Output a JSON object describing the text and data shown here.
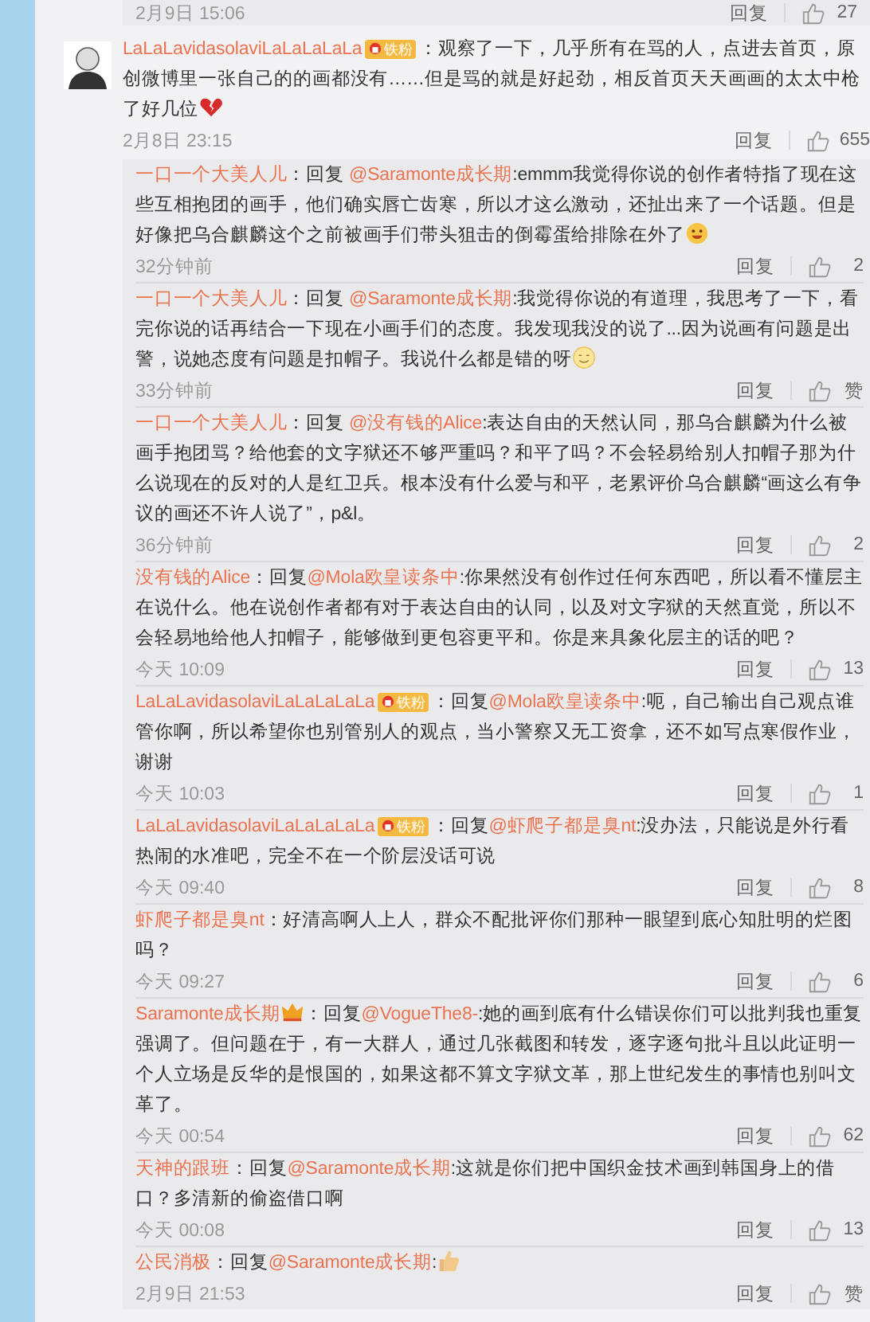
{
  "top_meta": {
    "time": "2月9日 15:06",
    "reply": "回复",
    "likes": "27"
  },
  "comment": {
    "parts": [
      {
        "kind": "user",
        "text": "LaLaLavidasolaviLaLaLaLaLa"
      },
      {
        "kind": "badge",
        "text": "铁粉"
      },
      {
        "kind": "text",
        "text": "：观察了一下，几乎所有在骂的人，点进去首页，原创微博里一张自己的的画都没有……但是骂的就是好起劲，相反首页天天画画的太太中枪了好几位"
      },
      {
        "kind": "heart"
      }
    ],
    "time": "2月8日 23:15",
    "reply": "回复",
    "likes": "655"
  },
  "replies": [
    {
      "parts": [
        {
          "kind": "user",
          "text": "一口一个大美人儿"
        },
        {
          "kind": "text",
          "text": "：回复 "
        },
        {
          "kind": "mention",
          "text": "@Saramonte成长期"
        },
        {
          "kind": "text",
          "text": ":emmm我觉得你说的创作者特指了现在这些互相抱团的画手，他们确实唇亡齿寒，所以才这么激动，还扯出来了一个话题。但是好像把乌合麒麟这个之前被画手们带头狙击的倒霉蛋给排除在外了"
        },
        {
          "kind": "grin"
        }
      ],
      "time": "32分钟前",
      "reply": "回复",
      "likes": "2"
    },
    {
      "parts": [
        {
          "kind": "user",
          "text": "一口一个大美人儿"
        },
        {
          "kind": "text",
          "text": "：回复 "
        },
        {
          "kind": "mention",
          "text": "@Saramonte成长期"
        },
        {
          "kind": "text",
          "text": ":我觉得你说的有道理，我思考了一下，看完你说的话再结合一下现在小画手们的态度。我发现我没的说了...因为说画有问题是出警，说她态度有问题是扣帽子。我说什么都是错的呀"
        },
        {
          "kind": "smile"
        }
      ],
      "time": "33分钟前",
      "reply": "回复",
      "likes": "赞"
    },
    {
      "parts": [
        {
          "kind": "user",
          "text": "一口一个大美人儿"
        },
        {
          "kind": "text",
          "text": "：回复 "
        },
        {
          "kind": "mention",
          "text": "@没有钱的Alice"
        },
        {
          "kind": "text",
          "text": ":表达自由的天然认同，那乌合麒麟为什么被画手抱团骂？给他套的文字狱还不够严重吗？和平了吗？不会轻易给别人扣帽子那为什么说现在的反对的人是红卫兵。根本没有什么爱与和平，老累评价乌合麒麟“画这么有争议的画还不许人说了”，p&l。"
        }
      ],
      "time": "36分钟前",
      "reply": "回复",
      "likes": "2"
    },
    {
      "parts": [
        {
          "kind": "user",
          "text": "没有钱的Alice"
        },
        {
          "kind": "text",
          "text": "：回复"
        },
        {
          "kind": "mention",
          "text": "@Mola欧皇读条中"
        },
        {
          "kind": "text",
          "text": ":你果然没有创作过任何东西吧，所以看不懂层主在说什么。他在说创作者都有对于表达自由的认同，以及对文字狱的天然直觉，所以不会轻易地给他人扣帽子，能够做到更包容更平和。你是来具象化层主的话的吧？"
        }
      ],
      "time": "今天 10:09",
      "reply": "回复",
      "likes": "13"
    },
    {
      "parts": [
        {
          "kind": "user",
          "text": "LaLaLavidasolaviLaLaLaLaLa"
        },
        {
          "kind": "badge",
          "text": "铁粉"
        },
        {
          "kind": "text",
          "text": "：回复"
        },
        {
          "kind": "mention",
          "text": "@Mola欧皇读条中"
        },
        {
          "kind": "text",
          "text": ":呃，自己输出自己观点谁管你啊，所以希望你也别管别人的观点，当小警察又无工资拿，还不如写点寒假作业，谢谢"
        }
      ],
      "time": "今天 10:03",
      "reply": "回复",
      "likes": "1"
    },
    {
      "parts": [
        {
          "kind": "user",
          "text": "LaLaLavidasolaviLaLaLaLaLa"
        },
        {
          "kind": "badge",
          "text": "铁粉"
        },
        {
          "kind": "text",
          "text": "：回复"
        },
        {
          "kind": "mention",
          "text": "@虾爬子都是臭nt"
        },
        {
          "kind": "text",
          "text": ":没办法，只能说是外行看热闹的水准吧，完全不在一个阶层没话可说"
        }
      ],
      "time": "今天 09:40",
      "reply": "回复",
      "likes": "8"
    },
    {
      "parts": [
        {
          "kind": "user",
          "text": "虾爬子都是臭nt"
        },
        {
          "kind": "text",
          "text": "：好清高啊人上人，群众不配批评你们那种一眼望到底心知肚明的烂图吗？"
        }
      ],
      "time": "今天 09:27",
      "reply": "回复",
      "likes": "6"
    },
    {
      "parts": [
        {
          "kind": "user",
          "text": "Saramonte成长期"
        },
        {
          "kind": "crown"
        },
        {
          "kind": "text",
          "text": "：回复"
        },
        {
          "kind": "mention",
          "text": "@VogueThe8-"
        },
        {
          "kind": "text",
          "text": ":她的画到底有什么错误你们可以批判我也重复强调了。但问题在于，有一大群人，通过几张截图和转发，逐字逐句批斗且以此证明一个人立场是反华的是恨国的，如果这都不算文字狱文革，那上世纪发生的事情也别叫文革了。"
        }
      ],
      "time": "今天 00:54",
      "reply": "回复",
      "likes": "62"
    },
    {
      "parts": [
        {
          "kind": "user",
          "text": "天神的跟班"
        },
        {
          "kind": "text",
          "text": "：回复"
        },
        {
          "kind": "mention",
          "text": "@Saramonte成长期"
        },
        {
          "kind": "text",
          "text": ":这就是你们把中国织金技术画到韩国身上的借口？多清新的偷盗借口啊"
        }
      ],
      "time": "今天 00:08",
      "reply": "回复",
      "likes": "13"
    },
    {
      "parts": [
        {
          "kind": "user",
          "text": "公民消极"
        },
        {
          "kind": "text",
          "text": "：回复"
        },
        {
          "kind": "mention",
          "text": "@Saramonte成长期"
        },
        {
          "kind": "text",
          "text": ":"
        },
        {
          "kind": "thumb"
        }
      ],
      "time": "2月9日 21:53",
      "reply": "回复",
      "likes": "赞"
    }
  ]
}
